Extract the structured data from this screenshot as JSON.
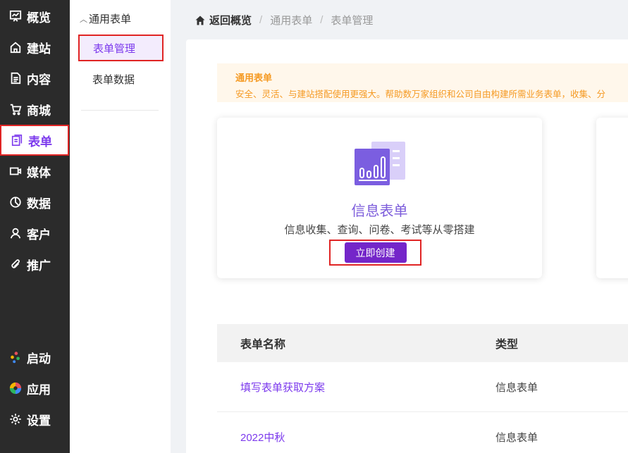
{
  "nav": {
    "items": [
      {
        "label": "概览",
        "icon": "overview-icon"
      },
      {
        "label": "建站",
        "icon": "home-icon"
      },
      {
        "label": "内容",
        "icon": "document-icon"
      },
      {
        "label": "商城",
        "icon": "cart-icon"
      },
      {
        "label": "表单",
        "icon": "form-icon"
      },
      {
        "label": "媒体",
        "icon": "video-icon"
      },
      {
        "label": "数据",
        "icon": "pie-chart-icon"
      },
      {
        "label": "客户",
        "icon": "user-icon"
      },
      {
        "label": "推广",
        "icon": "paperclip-icon"
      }
    ],
    "active_item": "表单",
    "bottom_items": [
      {
        "label": "启动",
        "icon": "launch-icon"
      },
      {
        "label": "应用",
        "icon": "apps-icon"
      },
      {
        "label": "设置",
        "icon": "gear-icon"
      }
    ]
  },
  "submenu": {
    "group_label": "通用表单",
    "items": [
      {
        "label": "表单管理"
      },
      {
        "label": "表单数据"
      }
    ],
    "active_item": "表单管理"
  },
  "breadcrumb": {
    "home": "返回概览",
    "items": [
      "通用表单",
      "表单管理"
    ]
  },
  "notice": {
    "title": "通用表单",
    "text": "安全、灵活、与建站搭配使用更强大。帮助数万家组织和公司自由构建所需业务表单，收集、分"
  },
  "card": {
    "title": "信息表单",
    "description": "信息收集、查询、问卷、考试等从零搭建",
    "button": "立即创建"
  },
  "table": {
    "headers": [
      "表单名称",
      "类型"
    ],
    "rows": [
      {
        "name": "填写表单获取方案",
        "type": "信息表单"
      },
      {
        "name": "2022中秋",
        "type": "信息表单"
      }
    ]
  },
  "colors": {
    "accent": "#7c3aed",
    "button": "#7426c9",
    "nav_bg": "#2b2b2b",
    "notice": "#f59a23",
    "highlight_border": "#e02424"
  }
}
